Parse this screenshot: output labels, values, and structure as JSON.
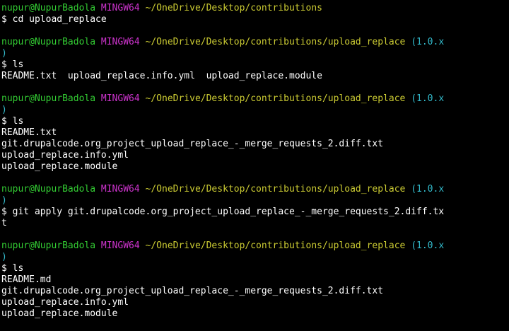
{
  "colors": {
    "background": "#000000",
    "user": "#33cc33",
    "mingw": "#cc33cc",
    "path": "#cccc33",
    "branch": "#33bbcc",
    "text": "#ffffff"
  },
  "lines": [
    {
      "type": "prompt",
      "user": "nupur@NupurBadola",
      "mingw": "MINGW64",
      "path": "~/OneDrive/Desktop/contributions",
      "branch": ""
    },
    {
      "type": "text",
      "text": "$ cd upload_replace"
    },
    {
      "type": "blank",
      "text": ""
    },
    {
      "type": "prompt",
      "user": "nupur@NupurBadola",
      "mingw": "MINGW64",
      "path": "~/OneDrive/Desktop/contributions/upload_replace",
      "branch": "(1.0.x"
    },
    {
      "type": "branch_end",
      "text": ")"
    },
    {
      "type": "text",
      "text": "$ ls"
    },
    {
      "type": "text",
      "text": "README.txt  upload_replace.info.yml  upload_replace.module"
    },
    {
      "type": "blank",
      "text": ""
    },
    {
      "type": "prompt",
      "user": "nupur@NupurBadola",
      "mingw": "MINGW64",
      "path": "~/OneDrive/Desktop/contributions/upload_replace",
      "branch": "(1.0.x"
    },
    {
      "type": "branch_end",
      "text": ")"
    },
    {
      "type": "text",
      "text": "$ ls"
    },
    {
      "type": "text",
      "text": "README.txt"
    },
    {
      "type": "text",
      "text": "git.drupalcode.org_project_upload_replace_-_merge_requests_2.diff.txt"
    },
    {
      "type": "text",
      "text": "upload_replace.info.yml"
    },
    {
      "type": "text",
      "text": "upload_replace.module"
    },
    {
      "type": "blank",
      "text": ""
    },
    {
      "type": "prompt",
      "user": "nupur@NupurBadola",
      "mingw": "MINGW64",
      "path": "~/OneDrive/Desktop/contributions/upload_replace",
      "branch": "(1.0.x"
    },
    {
      "type": "branch_end",
      "text": ")"
    },
    {
      "type": "text",
      "text": "$ git apply git.drupalcode.org_project_upload_replace_-_merge_requests_2.diff.tx"
    },
    {
      "type": "text",
      "text": "t"
    },
    {
      "type": "blank",
      "text": ""
    },
    {
      "type": "prompt",
      "user": "nupur@NupurBadola",
      "mingw": "MINGW64",
      "path": "~/OneDrive/Desktop/contributions/upload_replace",
      "branch": "(1.0.x"
    },
    {
      "type": "branch_end",
      "text": ")"
    },
    {
      "type": "text",
      "text": "$ ls"
    },
    {
      "type": "text",
      "text": "README.md"
    },
    {
      "type": "text",
      "text": "git.drupalcode.org_project_upload_replace_-_merge_requests_2.diff.txt"
    },
    {
      "type": "text",
      "text": "upload_replace.info.yml"
    },
    {
      "type": "text",
      "text": "upload_replace.module"
    }
  ]
}
